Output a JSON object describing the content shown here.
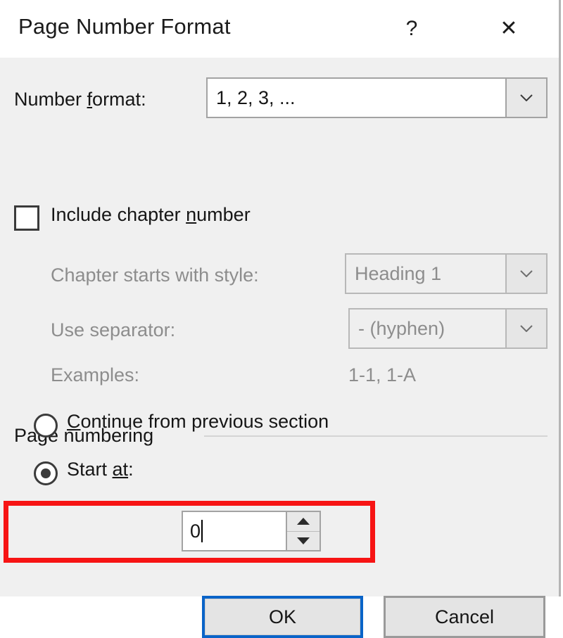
{
  "window": {
    "title": "Page Number Format",
    "help_icon": "question-mark-icon",
    "close_icon": "close-x-icon",
    "help_label": "?",
    "close_label": "✕"
  },
  "fields": {
    "number_format": {
      "label_before": "Number ",
      "label_accel": "f",
      "label_after": "ormat:",
      "label_full": "Number format:",
      "value": "1, 2, 3, ...",
      "enabled": true
    },
    "include_chapter_number": {
      "label_before": "Include chapter ",
      "label_accel": "n",
      "label_after": "umber",
      "label_full": "Include chapter number",
      "checked": false
    },
    "chapter_starts_with_style": {
      "label": "Chapter starts with style:",
      "value": "Heading 1",
      "enabled": false
    },
    "use_separator": {
      "label": "Use separator:",
      "value": "-   (hyphen)",
      "enabled": false
    },
    "examples": {
      "label": "Examples:",
      "value": "1-1, 1-A",
      "enabled": false
    }
  },
  "page_numbering": {
    "group_title": "Page numbering",
    "continue_option": {
      "label_accel": "C",
      "label_after": "ontinue from previous section",
      "label_full": "Continue from previous section",
      "selected": false
    },
    "start_at_option": {
      "label_before": "Start ",
      "label_accel": "at",
      "label_after": ":",
      "label_full": "Start at:",
      "selected": true,
      "value": "0",
      "spinner_up_icon": "triangle-up-icon",
      "spinner_down_icon": "triangle-down-icon"
    }
  },
  "footer": {
    "ok_label": "OK",
    "cancel_label": "Cancel"
  },
  "annotation": {
    "highlight_color": "#f71414",
    "focus_color": "#0a64c8"
  }
}
